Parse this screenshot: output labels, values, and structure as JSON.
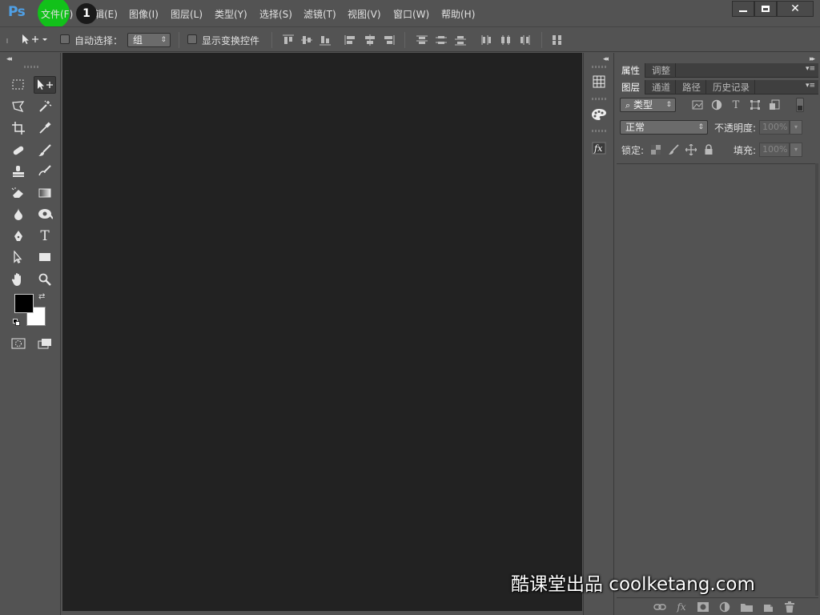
{
  "app": {
    "logo": "Ps"
  },
  "menu": {
    "items": [
      {
        "label": "文件(F)"
      },
      {
        "label": "编辑(E)"
      },
      {
        "label": "图像(I)"
      },
      {
        "label": "图层(L)"
      },
      {
        "label": "类型(Y)"
      },
      {
        "label": "选择(S)"
      },
      {
        "label": "滤镜(T)"
      },
      {
        "label": "视图(V)"
      },
      {
        "label": "窗口(W)"
      },
      {
        "label": "帮助(H)"
      }
    ],
    "highlight_color": "#12c11a",
    "step_badge": "1"
  },
  "window_controls": {
    "minimize": "minimize-icon",
    "maximize": "maximize-icon",
    "close": "close-icon"
  },
  "options": {
    "auto_select_label": "自动选择：",
    "auto_select_value": "组",
    "show_transform_label": "显示变换控件"
  },
  "panels": {
    "top_tabs": [
      "属性",
      "调整"
    ],
    "layer_tabs": [
      "图层",
      "通道",
      "路径",
      "历史记录"
    ],
    "filter_kind": "类型",
    "blend_mode": "正常",
    "opacity_label": "不透明度:",
    "opacity_value": "100%",
    "lock_label": "锁定:",
    "fill_label": "填充:",
    "fill_value": "100%"
  },
  "watermark": "酷课堂出品 coolketang.com",
  "colors": {
    "accent": "#4fa0e6",
    "canvas": "#222222",
    "chrome": "#535353",
    "foreground_swatch": "#000000",
    "background_swatch": "#ffffff"
  }
}
